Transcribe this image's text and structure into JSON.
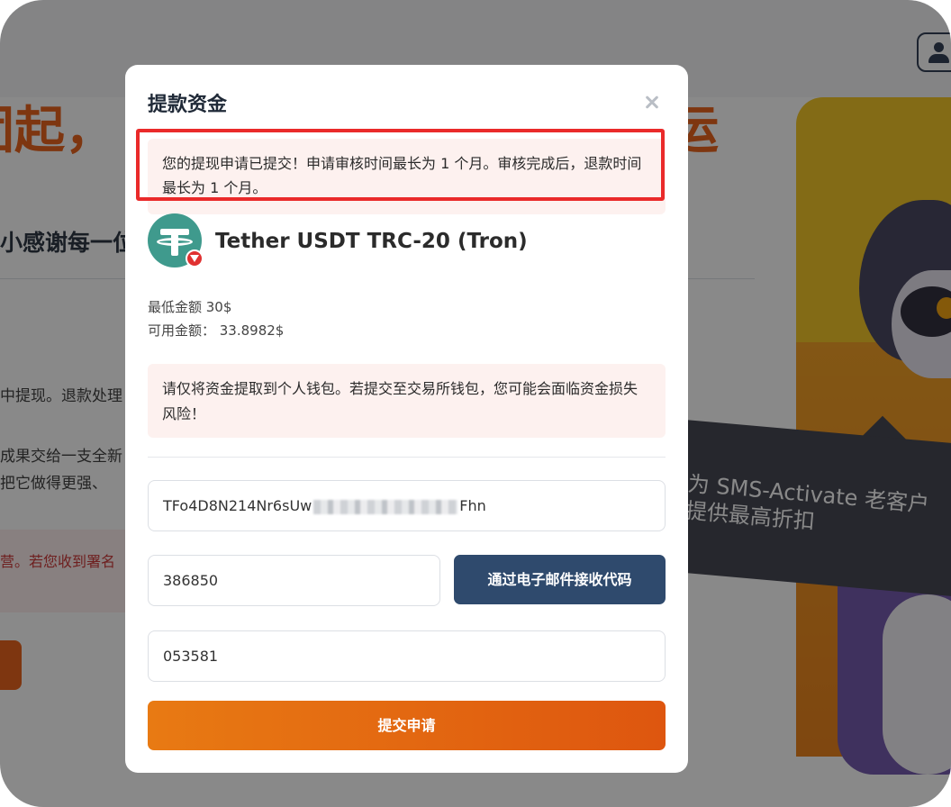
{
  "background": {
    "title_left": "团起，",
    "title_right": "运",
    "subtitle": "小感谢每一位",
    "paragraph_1": "中提现。退款处理",
    "paragraph_2": "成果交给一支全新",
    "paragraph_3": "把它做得更强、",
    "warning_text": "营。若您收到署名",
    "promo_line_1": "为 SMS-Activate 老客户",
    "promo_line_2": "提供最高折扣"
  },
  "modal": {
    "title": "提款资金",
    "success_message": "您的提现申请已提交！申请审核时间最长为 1 个月。审核完成后，退款时间最长为 1 个月。",
    "coin": {
      "name": "Tether USDT TRC-20 (Tron)",
      "icon": "tether-icon",
      "badge_icon": "tron-icon"
    },
    "min_amount": "最低金额 30$",
    "available_amount": "可用金额： 33.8982$",
    "warning_message": "请仅将资金提取到个人钱包。若提交至交易所钱包，您可能会面临资金损失风险！",
    "wallet_address_prefix": "TFo4D8N214Nr6sUw",
    "wallet_address_suffix": "Fhn",
    "email_code_value": "386850",
    "email_code_button": "通过电子邮件接收代码",
    "second_code_value": "053581",
    "submit_button": "提交申请"
  },
  "colors": {
    "accent_orange": "#e8590c",
    "button_navy": "#2f4a6d",
    "highlight_red": "#ea2a2a",
    "tether_green": "#3f9a8d"
  }
}
